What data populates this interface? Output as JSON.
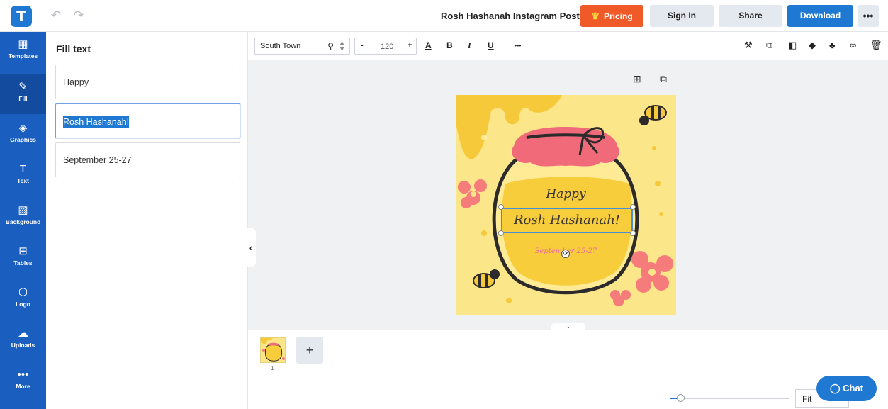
{
  "app": {
    "logo_letter": "T"
  },
  "header": {
    "undo_icon": "↶",
    "redo_icon": "↷",
    "doc_title": "Rosh Hashanah Instagram Post",
    "pricing_label": "Pricing",
    "signin_label": "Sign In",
    "share_label": "Share",
    "download_label": "Download",
    "more_label": "•••"
  },
  "sidebar": {
    "items": [
      {
        "icon": "▦",
        "label": "Templates"
      },
      {
        "icon": "✎",
        "label": "Fill"
      },
      {
        "icon": "◈",
        "label": "Graphics"
      },
      {
        "icon": "T",
        "label": "Text"
      },
      {
        "icon": "▨",
        "label": "Background"
      },
      {
        "icon": "⊞",
        "label": "Tables"
      },
      {
        "icon": "⬡",
        "label": "Logo"
      },
      {
        "icon": "☁",
        "label": "Uploads"
      },
      {
        "icon": "•••",
        "label": "More"
      }
    ]
  },
  "panel": {
    "title": "Fill text",
    "fields": [
      "Happy",
      "Rosh Hashanah!",
      "September 25-27"
    ],
    "drag_icon": "⋮⋮"
  },
  "toolbar": {
    "font_name": "South Town",
    "font_size": "120",
    "minus": "-",
    "plus": "+",
    "color_label": "A",
    "bold_label": "B",
    "italic_label": "I",
    "underline_label": "U",
    "more_label": "•••"
  },
  "canvas": {
    "add_icon": "⊞",
    "copy_icon": "⧉",
    "design_text": {
      "happy": "Happy",
      "main": "Rosh Hashanah!",
      "dates": "September 25-27"
    }
  },
  "pages": {
    "page_number": "1",
    "add_label": "+"
  },
  "zoom": {
    "value_label": "Fit",
    "level": 0.08
  },
  "chat": {
    "label": "Chat"
  },
  "colors": {
    "brand_blue": "#1f78d1",
    "pricing_orange": "#f05a28",
    "artboard_yellow": "#fce68a",
    "honey": "#f6c93a",
    "lid_pink": "#f06a7a"
  }
}
